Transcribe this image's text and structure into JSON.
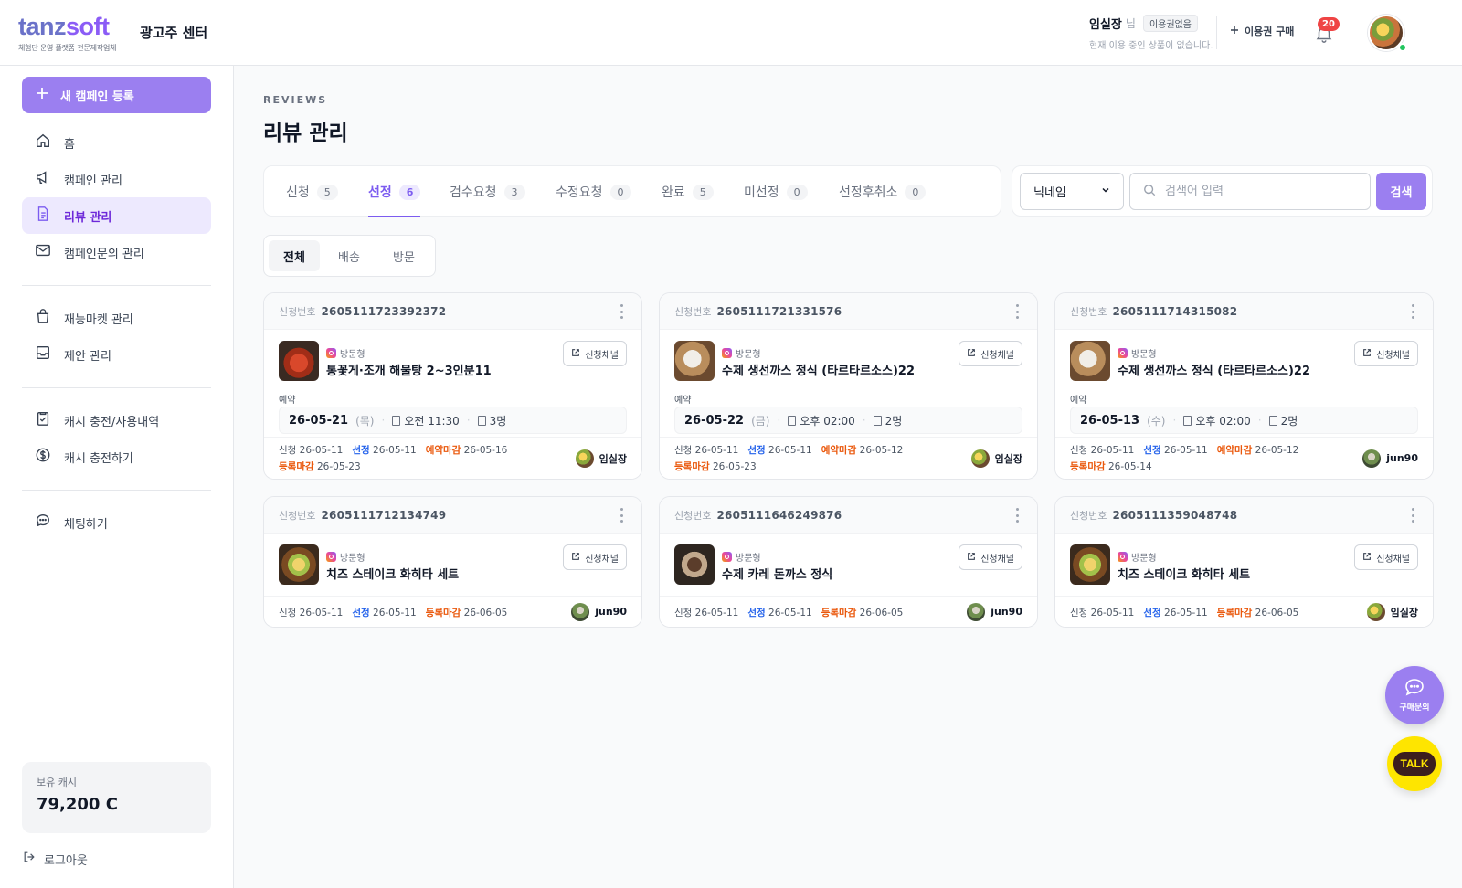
{
  "header": {
    "logo_part1": "tanz",
    "logo_part2": "soft",
    "logo_tagline": "체험단 운영 플랫폼 전문제작업체",
    "center_name": "광고주 센터",
    "user_name": "임실장",
    "user_suffix": "님",
    "user_badge": "이용권없음",
    "user_sub": "현재 이용 중인 상품이 없습니다.",
    "buy_label": "이용권 구매",
    "notif_count": "20"
  },
  "sidebar": {
    "new_campaign": "새 캠페인 등록",
    "items": [
      {
        "label": "홈",
        "icon": "home-icon"
      },
      {
        "label": "캠페인 관리",
        "icon": "megaphone-icon"
      },
      {
        "label": "리뷰 관리",
        "icon": "document-icon",
        "active": true
      },
      {
        "label": "캠페인문의 관리",
        "icon": "mail-icon"
      },
      {
        "label": "재능마켓 관리",
        "icon": "bag-icon"
      },
      {
        "label": "제안 관리",
        "icon": "inbox-icon"
      },
      {
        "label": "캐시 충전/사용내역",
        "icon": "clipboard-icon"
      },
      {
        "label": "캐시 충전하기",
        "icon": "dollar-icon"
      },
      {
        "label": "채팅하기",
        "icon": "chat-icon"
      }
    ],
    "cash_label": "보유 캐시",
    "cash_value": "79,200 C",
    "logout": "로그아웃"
  },
  "main": {
    "eyebrow": "REVIEWS",
    "title": "리뷰 관리",
    "tabs": [
      {
        "label": "신청",
        "count": "5"
      },
      {
        "label": "선정",
        "count": "6",
        "active": true
      },
      {
        "label": "검수요청",
        "count": "3"
      },
      {
        "label": "수정요청",
        "count": "0"
      },
      {
        "label": "완료",
        "count": "5"
      },
      {
        "label": "미선정",
        "count": "0"
      },
      {
        "label": "선정후취소",
        "count": "0"
      }
    ],
    "search": {
      "select_value": "닉네임",
      "placeholder": "검색어 입력",
      "button": "검색"
    },
    "subtabs": [
      {
        "label": "전체",
        "active": true
      },
      {
        "label": "배송"
      },
      {
        "label": "방문"
      }
    ],
    "labels": {
      "app_no": "신청번호",
      "channel_btn": "신청채널",
      "type": "방문형",
      "reservation": "예약",
      "applied": "신청",
      "selected": "선정",
      "resv_deadline": "예약마감",
      "reg_deadline": "등록마감"
    },
    "cards": [
      {
        "app_no": "2605111723392372",
        "title": "통꽃게·조개 해물탕 2~3인분11",
        "resv_date": "26-05-21",
        "resv_dow": "(목)",
        "resv_time": "오전 11:30",
        "resv_people": "3명",
        "applied": "26-05-11",
        "selected": "26-05-11",
        "resv_deadline": "26-05-16",
        "reg_deadline": "26-05-23",
        "assignee": "임실장"
      },
      {
        "app_no": "2605111721331576",
        "title": "수제 생선까스 정식 (타르타르소스)22",
        "resv_date": "26-05-22",
        "resv_dow": "(금)",
        "resv_time": "오후 02:00",
        "resv_people": "2명",
        "applied": "26-05-11",
        "selected": "26-05-11",
        "resv_deadline": "26-05-12",
        "reg_deadline": "26-05-23",
        "assignee": "임실장"
      },
      {
        "app_no": "2605111714315082",
        "title": "수제 생선까스 정식 (타르타르소스)22",
        "resv_date": "26-05-13",
        "resv_dow": "(수)",
        "resv_time": "오후 02:00",
        "resv_people": "2명",
        "applied": "26-05-11",
        "selected": "26-05-11",
        "resv_deadline": "26-05-12",
        "reg_deadline": "26-05-14",
        "assignee": "jun90"
      },
      {
        "app_no": "2605111712134749",
        "title": "치즈 스테이크 화히타 세트",
        "applied": "26-05-11",
        "selected": "26-05-11",
        "reg_deadline": "26-06-05",
        "assignee": "jun90"
      },
      {
        "app_no": "2605111646249876",
        "title": "수제 카레 돈까스 정식",
        "applied": "26-05-11",
        "selected": "26-05-11",
        "reg_deadline": "26-06-05",
        "assignee": "jun90"
      },
      {
        "app_no": "2605111359048748",
        "title": "치즈 스테이크 화히타 세트",
        "applied": "26-05-11",
        "selected": "26-05-11",
        "reg_deadline": "26-06-05",
        "assignee": "임실장"
      }
    ]
  },
  "floating": {
    "inquiry": "구매문의",
    "talk": "TALK"
  },
  "colors": {
    "accent": "#9b7ff0",
    "accent_text": "#7c5cf0",
    "blue_label": "#2563eb",
    "orange_label": "#ea580c"
  }
}
